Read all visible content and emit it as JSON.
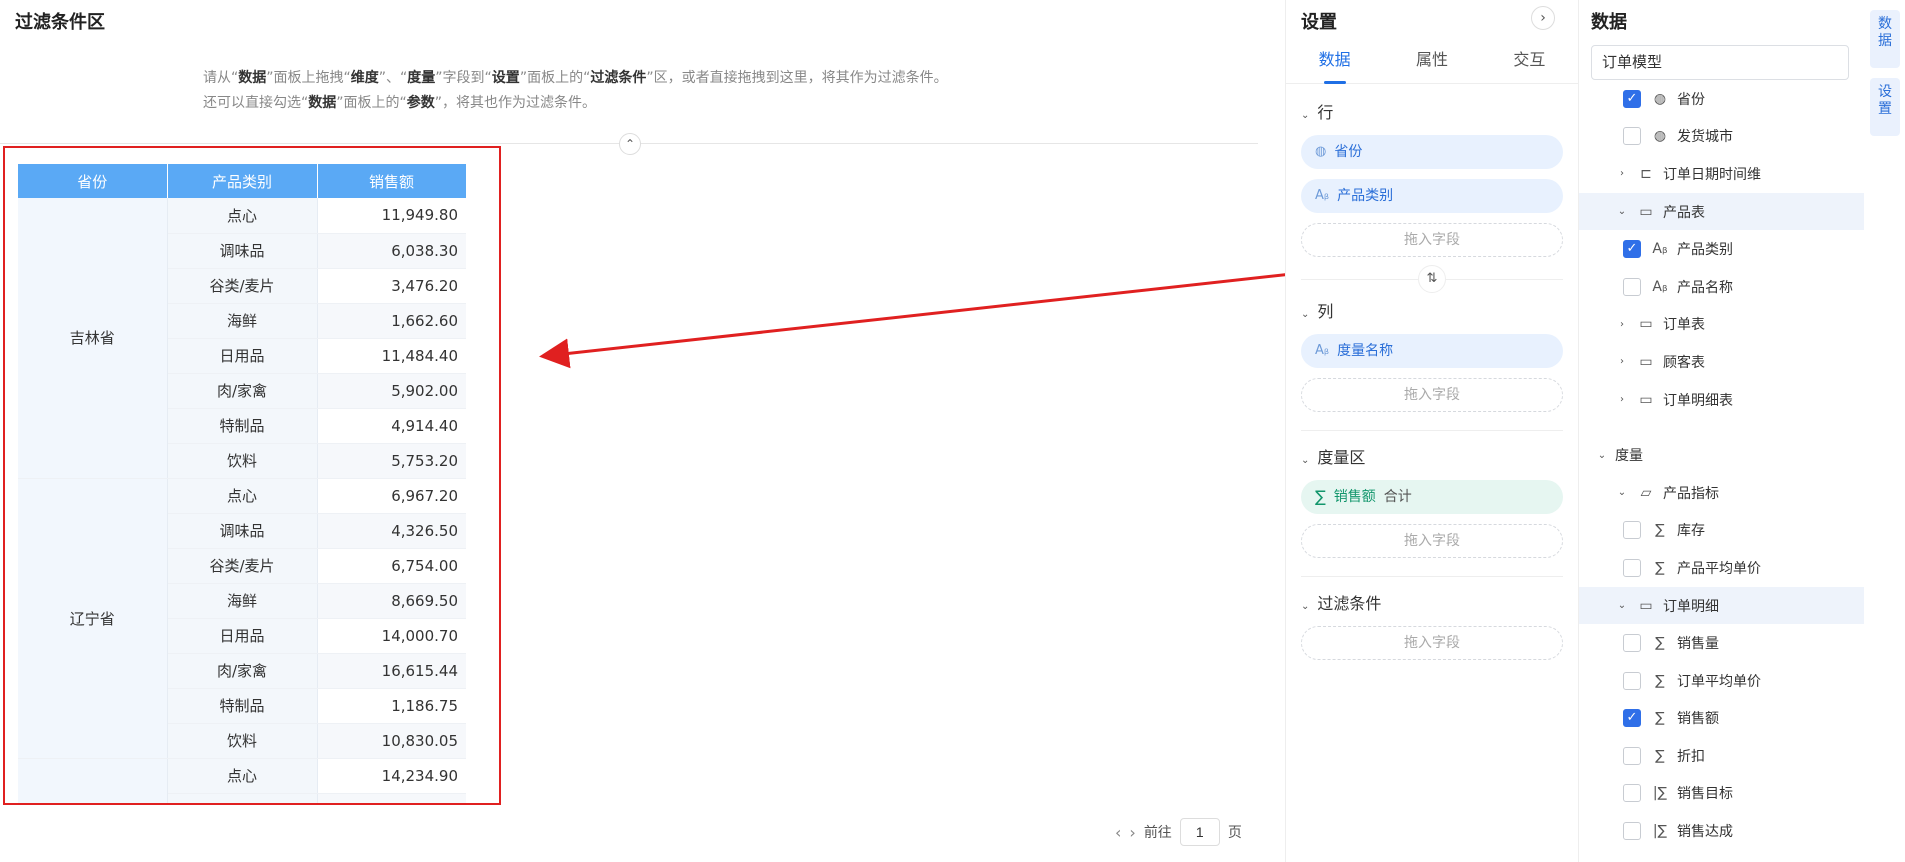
{
  "filter_area": {
    "title": "过滤条件区",
    "hint": {
      "l1_a": "请从“",
      "l1_b": "数据",
      "l1_c": "”面板上拖拽“",
      "l1_d": "维度",
      "l1_e": "”、“",
      "l1_f": "度量",
      "l1_g": "”字段到“",
      "l1_h": "设置",
      "l1_i": "”面板上的“",
      "l1_j": "过滤条件",
      "l1_k": "”区，或者直接拖拽到这里，将其作为过滤条件。",
      "l2_a": "还可以直接勾选“",
      "l2_b": "数据",
      "l2_c": "”面板上的“",
      "l2_d": "参数",
      "l2_e": "”，将其也作为过滤条件。"
    }
  },
  "table": {
    "headers": [
      "省份",
      "产品类别",
      "销售额"
    ],
    "groups": [
      {
        "province": "吉林省",
        "rows": [
          [
            "点心",
            "11,949.80"
          ],
          [
            "调味品",
            "6,038.30"
          ],
          [
            "谷类/麦片",
            "3,476.20"
          ],
          [
            "海鲜",
            "1,662.60"
          ],
          [
            "日用品",
            "11,484.40"
          ],
          [
            "肉/家禽",
            "5,902.00"
          ],
          [
            "特制品",
            "4,914.40"
          ],
          [
            "饮料",
            "5,753.20"
          ]
        ]
      },
      {
        "province": "辽宁省",
        "rows": [
          [
            "点心",
            "6,967.20"
          ],
          [
            "调味品",
            "4,326.50"
          ],
          [
            "谷类/麦片",
            "6,754.00"
          ],
          [
            "海鲜",
            "8,669.50"
          ],
          [
            "日用品",
            "14,000.70"
          ],
          [
            "肉/家禽",
            "16,615.44"
          ],
          [
            "特制品",
            "1,186.75"
          ],
          [
            "饮料",
            "10,830.05"
          ]
        ]
      },
      {
        "province": "",
        "rows": [
          [
            "点心",
            "14,234.90"
          ],
          [
            "",
            ""
          ]
        ]
      }
    ]
  },
  "pager": {
    "prev": "‹",
    "next": "›",
    "goto": "前往",
    "page": "1",
    "unit": "页"
  },
  "settings": {
    "title": "设置",
    "toggle": "›",
    "tabs": [
      "数据",
      "属性",
      "交互"
    ],
    "rows_label": "行",
    "rows_fields": [
      "省份",
      "产品类别"
    ],
    "cols_label": "列",
    "cols_fields": [
      "度量名称"
    ],
    "measure_label": "度量区",
    "measure_field": "销售额",
    "measure_agg": "合计",
    "filter_label": "过滤条件",
    "drop_hint": "拖入字段",
    "swap": "⇅"
  },
  "data_panel": {
    "title": "数据",
    "model": "订单模型",
    "tree": [
      {
        "label": "省份",
        "indent": 2,
        "check": "on",
        "icon": "globe"
      },
      {
        "label": "发货城市",
        "indent": 2,
        "check": "off",
        "icon": "globe"
      },
      {
        "label": "订单日期时间维",
        "indent": 1,
        "caret": "›",
        "icon": "hier"
      },
      {
        "label": "产品表",
        "indent": 1,
        "caret": "⌄",
        "icon": "folder-ok",
        "hl": true
      },
      {
        "label": "产品类别",
        "indent": 2,
        "check": "on",
        "icon": "text"
      },
      {
        "label": "产品名称",
        "indent": 2,
        "check": "off",
        "icon": "text"
      },
      {
        "label": "订单表",
        "indent": 1,
        "caret": "›",
        "icon": "folder"
      },
      {
        "label": "顾客表",
        "indent": 1,
        "caret": "›",
        "icon": "folder"
      },
      {
        "label": "订单明细表",
        "indent": 1,
        "caret": "›",
        "icon": "folder"
      },
      {
        "label": "",
        "indent": 0,
        "spacer": true
      },
      {
        "label": "度量",
        "indent": 0,
        "caret": "⌄"
      },
      {
        "label": "产品指标",
        "indent": 1,
        "caret": "⌄",
        "icon": "folder-open"
      },
      {
        "label": "库存",
        "indent": 2,
        "check": "off",
        "icon": "sigma"
      },
      {
        "label": "产品平均单价",
        "indent": 2,
        "check": "off",
        "icon": "sigma"
      },
      {
        "label": "订单明细",
        "indent": 1,
        "caret": "⌄",
        "icon": "folder-ok",
        "hl": true
      },
      {
        "label": "销售量",
        "indent": 2,
        "check": "off",
        "icon": "sigma"
      },
      {
        "label": "订单平均单价",
        "indent": 2,
        "check": "off",
        "icon": "sigma"
      },
      {
        "label": "销售额",
        "indent": 2,
        "check": "on",
        "icon": "sigma"
      },
      {
        "label": "折扣",
        "indent": 2,
        "check": "off",
        "icon": "sigma"
      },
      {
        "label": "销售目标",
        "indent": 2,
        "check": "off",
        "icon": "sigma2"
      },
      {
        "label": "销售达成",
        "indent": 2,
        "check": "off",
        "icon": "sigma2"
      }
    ]
  },
  "side_tabs": [
    "数据",
    "设置"
  ],
  "icons": {
    "globe": "◍",
    "text": "Aᵦ",
    "sigma": "∑",
    "sigma2": "|∑",
    "folder": "▭",
    "folder-ok": "▭",
    "folder-open": "▱",
    "hier": "⊏"
  },
  "colors": {
    "accent": "#1f6fe5",
    "header_blue": "#5aa9f5",
    "highlight_red": "#e02020",
    "measure_green": "#12966c"
  }
}
